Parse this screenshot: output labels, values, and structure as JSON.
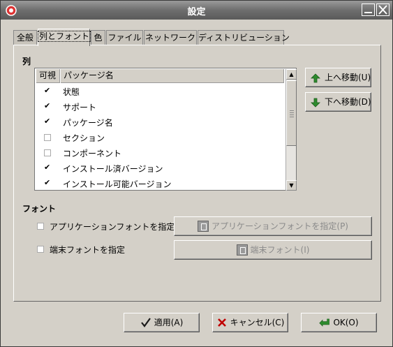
{
  "window": {
    "title": "設定"
  },
  "tabs": [
    {
      "label": "全般"
    },
    {
      "label": "列とフォント",
      "active": true
    },
    {
      "label": "色"
    },
    {
      "label": "ファイル"
    },
    {
      "label": "ネットワーク"
    },
    {
      "label": "ディストリビューション"
    }
  ],
  "columns_section": {
    "heading": "列",
    "header_visible": "可視",
    "header_name": "パッケージ名",
    "rows": [
      {
        "checked": true,
        "label": "状態"
      },
      {
        "checked": true,
        "label": "サポート"
      },
      {
        "checked": true,
        "label": "パッケージ名"
      },
      {
        "checked": false,
        "label": "セクション"
      },
      {
        "checked": false,
        "label": "コンポーネント"
      },
      {
        "checked": true,
        "label": "インストール済バージョン"
      },
      {
        "checked": true,
        "label": "インストール可能バージョン"
      }
    ],
    "move_up_label": "上へ移動(U)",
    "move_down_label": "下へ移動(D)"
  },
  "font_section": {
    "heading": "フォント",
    "app_font_check_label": "アプリケーションフォントを指定",
    "app_font_button_label": "アプリケーションフォントを指定(P)",
    "term_font_check_label": "端末フォントを指定",
    "term_font_button_label": "端末フォント(I)"
  },
  "buttons": {
    "apply": "適用(A)",
    "cancel": "キャンセル(C)",
    "ok": "OK(O)"
  },
  "colors": {
    "dialog_bg": "#d4d0c8",
    "titlebar": "#6e6e6e",
    "apply_check": "#1a1a1a",
    "cancel_x": "#c00000",
    "arrow_green": "#2e8b2e"
  }
}
